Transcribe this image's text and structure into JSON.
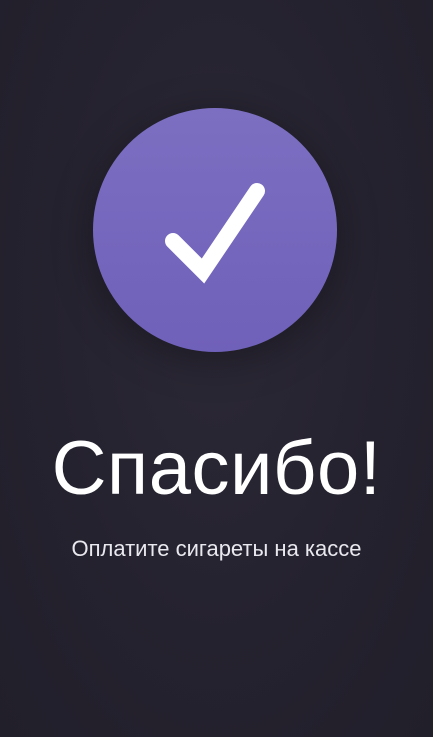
{
  "screen": {
    "title": "Спасибо!",
    "message": "Оплатите сигареты на кассе",
    "badge_icon": "checkmark-icon",
    "colors": {
      "background": "#25222f",
      "badge_top": "#7c6fc1",
      "badge_bottom": "#6f60b9",
      "text": "#ffffff"
    }
  }
}
